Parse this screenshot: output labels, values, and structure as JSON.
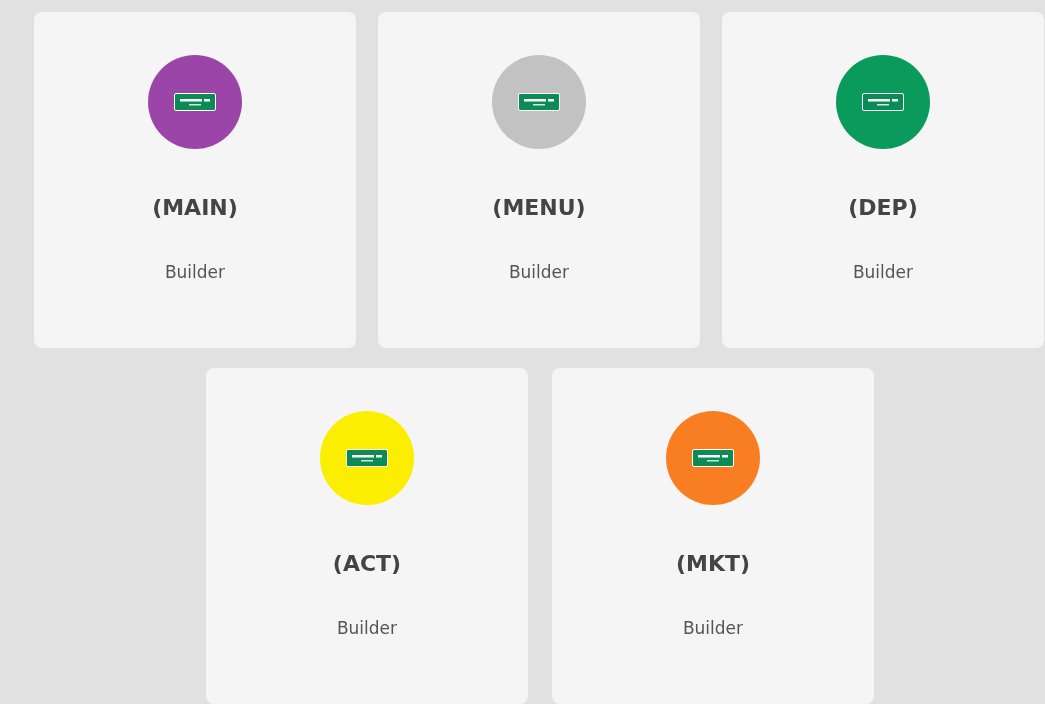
{
  "cards": [
    {
      "title": "(MAIN)",
      "subtitle": "Builder",
      "color": "#9c45a8"
    },
    {
      "title": "(MENU)",
      "subtitle": "Builder",
      "color": "#c2c2c2"
    },
    {
      "title": "(DEP)",
      "subtitle": "Builder",
      "color": "#0a9a5c"
    },
    {
      "title": "(ACT)",
      "subtitle": "Builder",
      "color": "#fcee00"
    },
    {
      "title": "(MKT)",
      "subtitle": "Builder",
      "color": "#f97e21"
    }
  ]
}
